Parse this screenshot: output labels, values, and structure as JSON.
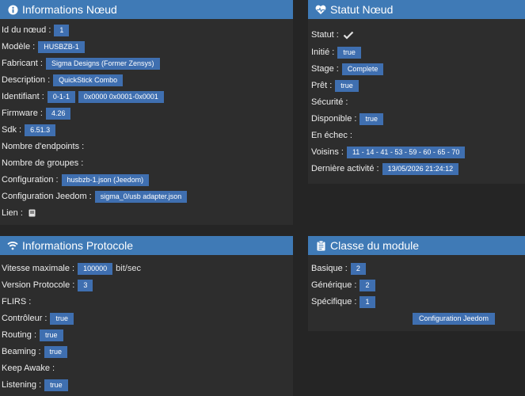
{
  "node_info": {
    "title": "Informations Nœud",
    "id_label": "Id du nœud :",
    "id_value": "1",
    "model_label": "Modèle :",
    "model_value": "HUSBZB-1",
    "maker_label": "Fabricant :",
    "maker_value": "Sigma Designs (Former Zensys)",
    "desc_label": "Description :",
    "desc_value": "QuickStick Combo",
    "ident_label": "Identifiant :",
    "ident_value_1": "0-1-1",
    "ident_value_2": "0x0000 0x0001-0x0001",
    "firmware_label": "Firmware :",
    "firmware_value": "4.26",
    "sdk_label": "Sdk :",
    "sdk_value": "6.51.3",
    "endpoints_label": "Nombre d'endpoints :",
    "groups_label": "Nombre de groupes :",
    "config_label": "Configuration :",
    "config_value": "husbzb-1.json (Jeedom)",
    "jeedom_config_label": "Configuration Jeedom :",
    "jeedom_config_value": "sigma_0/usb adapter.json",
    "link_label": "Lien :",
    "link_icon": "book-icon"
  },
  "node_status": {
    "title": "Statut Nœud",
    "status_label": "Statut :",
    "status_icon": "check-icon",
    "init_label": "Initié :",
    "init_value": "true",
    "stage_label": "Stage :",
    "stage_value": "Complete",
    "ready_label": "Prêt :",
    "ready_value": "true",
    "security_label": "Sécurité :",
    "available_label": "Disponible :",
    "available_value": "true",
    "failed_label": "En échec :",
    "neighbors_label": "Voisins :",
    "neighbors_value": "11 - 14 - 41 - 53 - 59 - 60 - 65 - 70",
    "last_activity_label": "Dernière activité :",
    "last_activity_value": "13/05/2026 21:24:12"
  },
  "protocol": {
    "title": "Informations Protocole",
    "speed_label": "Vitesse maximale :",
    "speed_value": "100000",
    "speed_unit": "bit/sec",
    "version_label": "Version Protocole :",
    "version_value": "3",
    "flirs_label": "FLIRS :",
    "controller_label": "Contrôleur :",
    "controller_value": "true",
    "routing_label": "Routing :",
    "routing_value": "true",
    "beaming_label": "Beaming :",
    "beaming_value": "true",
    "keepawake_label": "Keep Awake :",
    "listening_label": "Listening :",
    "listening_value": "true"
  },
  "module_class": {
    "title": "Classe du module",
    "basic_label": "Basique :",
    "basic_value": "2",
    "generic_label": "Générique :",
    "generic_value": "2",
    "specific_label": "Spécifique :",
    "specific_value": "1",
    "config_button": "Configuration Jeedom"
  },
  "colors": {
    "header": "#3f7ab6",
    "badge": "#3f6fb0",
    "panel": "#2d2d2d",
    "background": "#252525"
  }
}
